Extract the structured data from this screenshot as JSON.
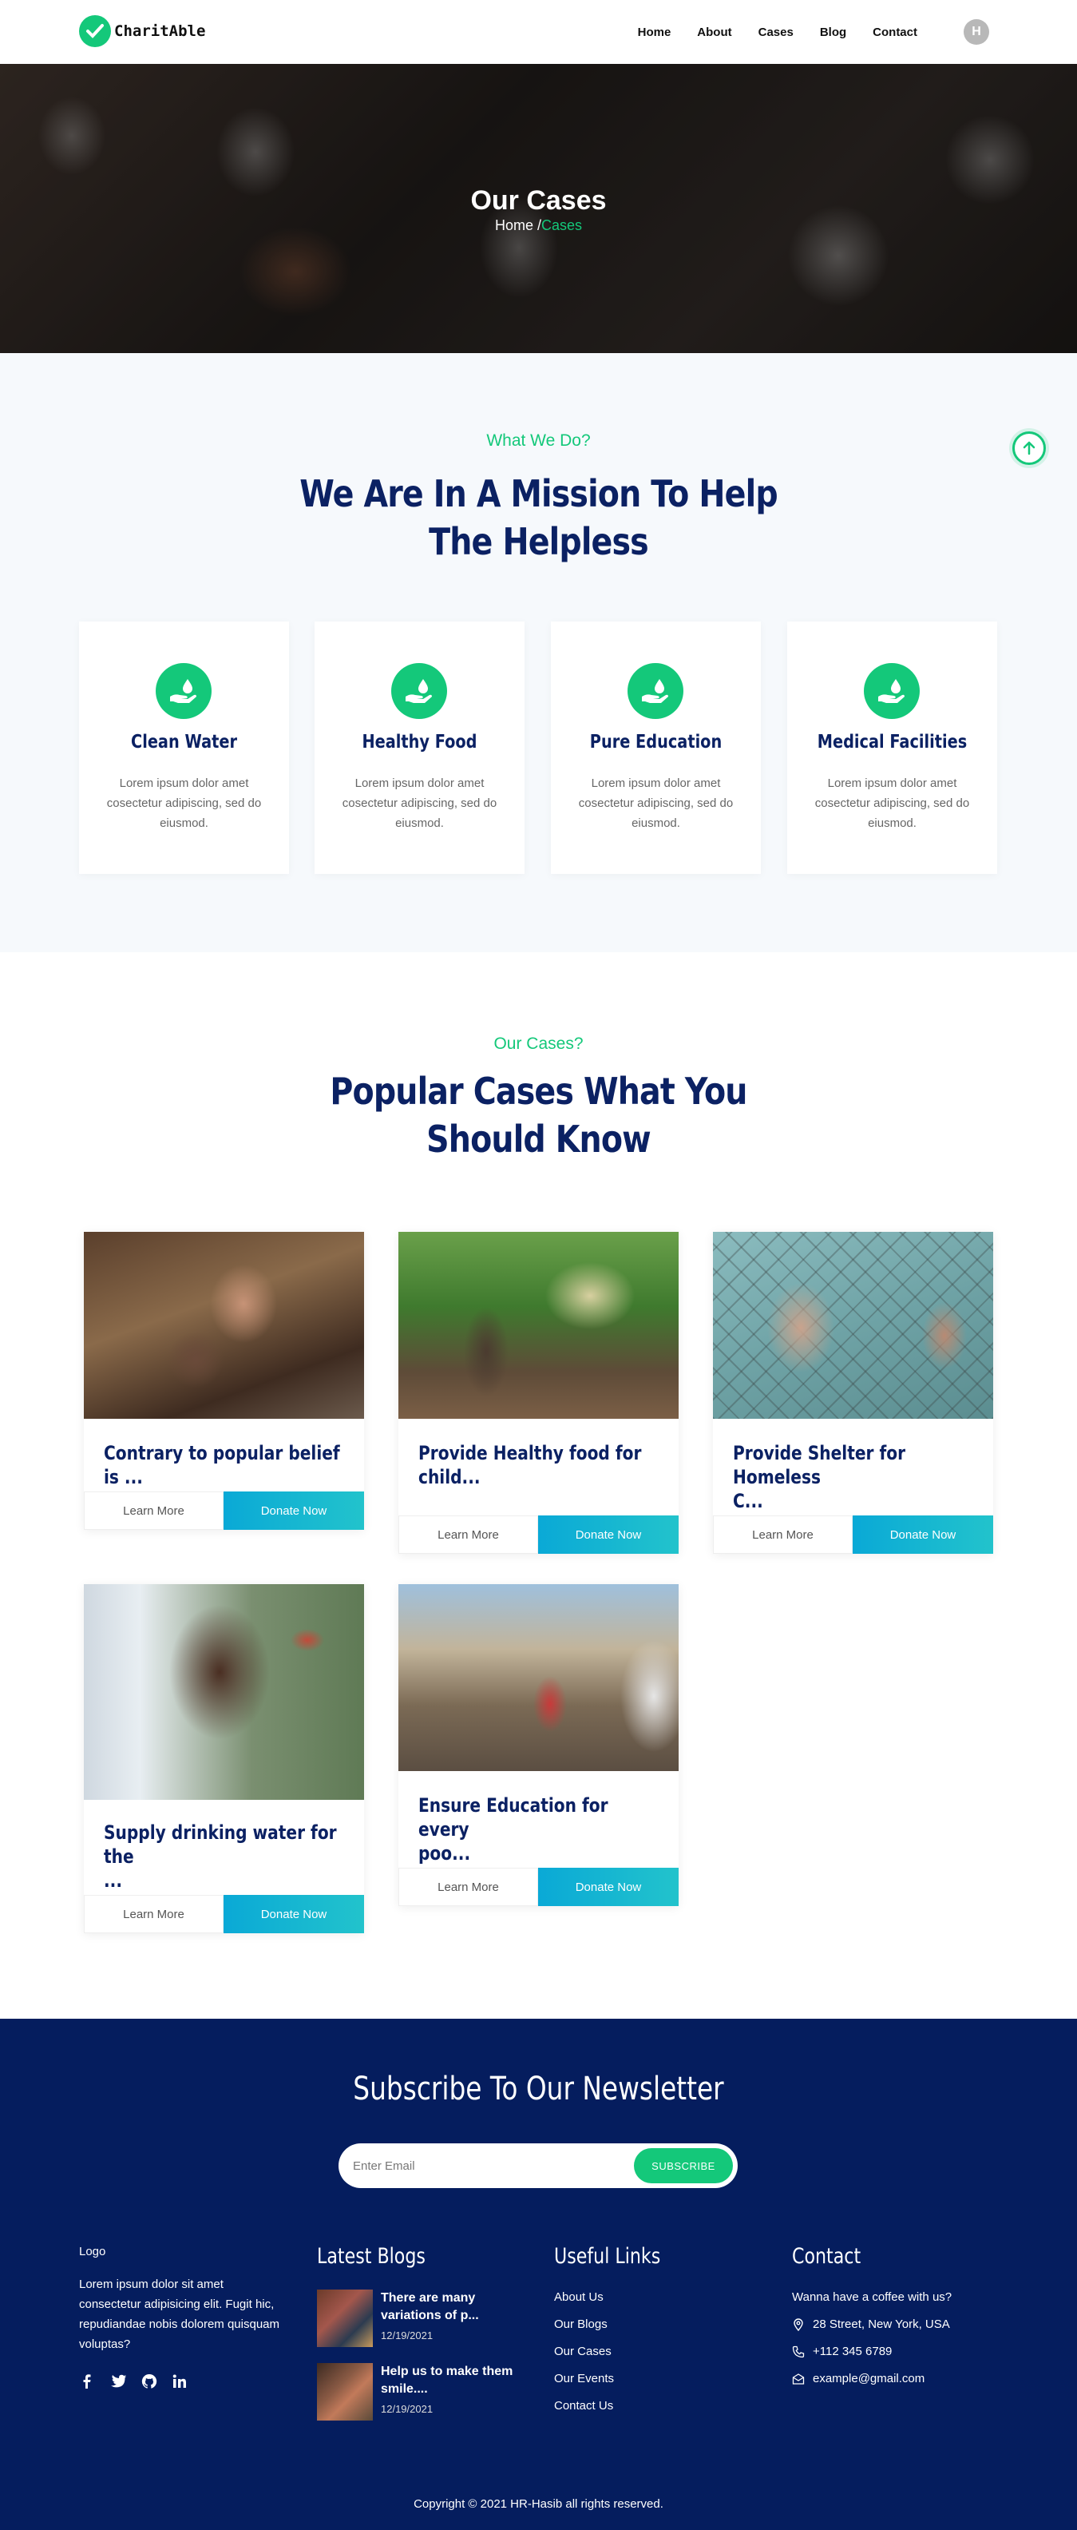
{
  "nav": {
    "brand": "CharitAble",
    "links": [
      "Home",
      "About",
      "Cases",
      "Blog",
      "Contact"
    ],
    "avatar_letter": "H"
  },
  "hero": {
    "title": "Our Cases",
    "crumb_home": "Home",
    "crumb_sep": " /",
    "crumb_active": "Cases"
  },
  "mission": {
    "eyebrow": "What We Do?",
    "title_line1": "We Are In A Mission To Help",
    "title_line2": "The Helpless",
    "features": [
      {
        "title": "Clean Water",
        "text": "Lorem ipsum dolor amet cosectetur adipiscing, sed do eiusmod."
      },
      {
        "title": "Healthy Food",
        "text": "Lorem ipsum dolor amet cosectetur adipiscing, sed do eiusmod."
      },
      {
        "title": "Pure Education",
        "text": "Lorem ipsum dolor amet cosectetur adipiscing, sed do eiusmod."
      },
      {
        "title": "Medical Facilities",
        "text": "Lorem ipsum dolor amet cosectetur adipiscing, sed do eiusmod."
      }
    ]
  },
  "cases": {
    "eyebrow": "Our Cases?",
    "title_line1": "Popular Cases What You",
    "title_line2": "Should Know",
    "learn_label": "Learn More",
    "donate_label": "Donate Now",
    "items": [
      {
        "title_l1": "Contrary to popular belief is ...",
        "title_l2": ""
      },
      {
        "title_l1": "Provide Healthy food for",
        "title_l2": "child..."
      },
      {
        "title_l1": "Provide Shelter for Homeless",
        "title_l2": "C..."
      },
      {
        "title_l1": "Supply drinking water for the",
        "title_l2": "..."
      },
      {
        "title_l1": "Ensure Education for every",
        "title_l2": "poo..."
      }
    ]
  },
  "footer": {
    "newsletter_title": "Subscribe To Our Newsletter",
    "email_placeholder": "Enter Email",
    "subscribe_label": "SUBSCRIBE",
    "logo_label": "Logo",
    "about": "Lorem ipsum dolor sit amet consectetur adipisicing elit. Fugit hic, repudiandae nobis dolorem quisquam voluptas?",
    "blogs_title": "Latest Blogs",
    "blogs": [
      {
        "title": "There are many variations of p...",
        "date": "12/19/2021"
      },
      {
        "title": "Help us to make them smile....",
        "date": "12/19/2021"
      }
    ],
    "links_title": "Useful Links",
    "links": [
      "About Us",
      "Our Blogs",
      "Our Cases",
      "Our Events",
      "Contact Us"
    ],
    "contact_title": "Contact",
    "contact_intro": "Wanna have a coffee with us?",
    "address": "28 Street, New York, USA",
    "phone": "+112 345 6789",
    "email": "example@gmail.com",
    "copyright": "Copyright © 2021 HR-Hasib all rights reserved."
  },
  "colors": {
    "accent_green": "#14c87a",
    "navy": "#0b2163",
    "footer_bg": "#051d5e",
    "donate_gradient_start": "#0aa9d6",
    "donate_gradient_end": "#22c3cc"
  }
}
